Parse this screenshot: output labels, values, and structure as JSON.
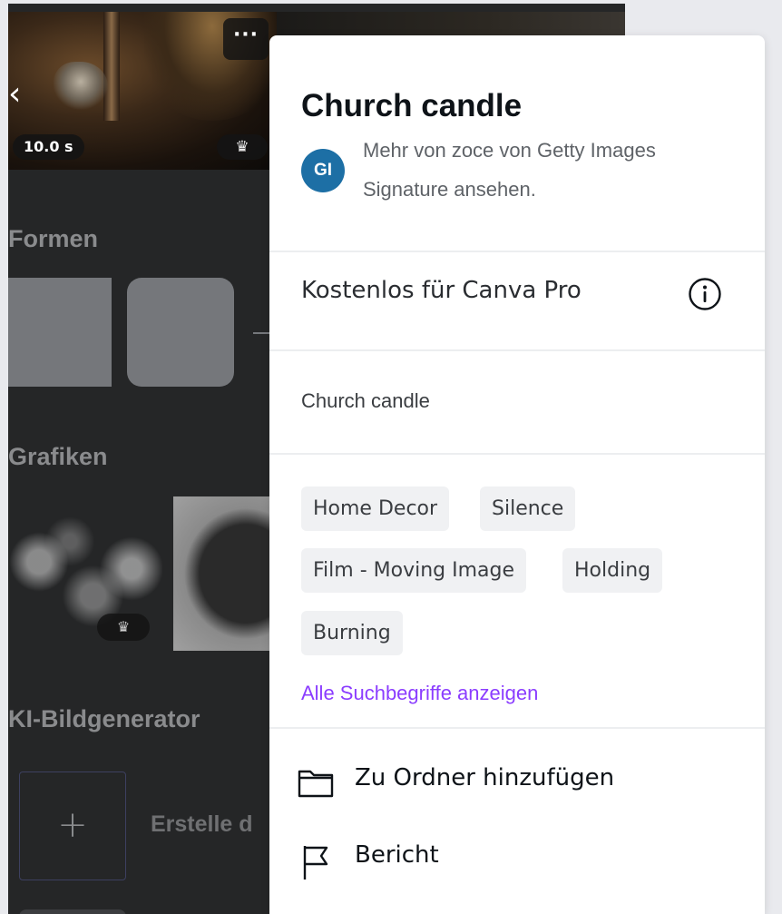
{
  "sidepanel": {
    "video_duration": "10.0 s",
    "more_button": "···",
    "section_shapes": "Formen",
    "section_graphics": "Grafiken",
    "section_ai": "KI-Bildgenerator",
    "ai_plus": "+",
    "ai_text": "Erstelle d"
  },
  "popover": {
    "title": "Church candle",
    "avatar_initials": "GI",
    "author_text": "Mehr von zoce von Getty Images Signature ansehen.",
    "license_text": "Kostenlos für Canva Pro",
    "description": "Church candle",
    "tags": [
      "Home Decor",
      "Silence",
      "Film - Moving Image",
      "Holding",
      "Burning"
    ],
    "all_keywords_link": "Alle Suchbegriffe anzeigen",
    "actions": {
      "add_to_folder": "Zu Ordner hinzufügen",
      "report": "Bericht"
    }
  },
  "icons": {
    "back": "chevron-left-icon",
    "crown": "crown-icon",
    "info": "info-icon",
    "folder": "folder-icon",
    "flag": "flag-icon"
  },
  "colors": {
    "panel_bg": "#252627",
    "link_purple": "#8b3dff",
    "avatar_blue": "#1d6fa5"
  }
}
